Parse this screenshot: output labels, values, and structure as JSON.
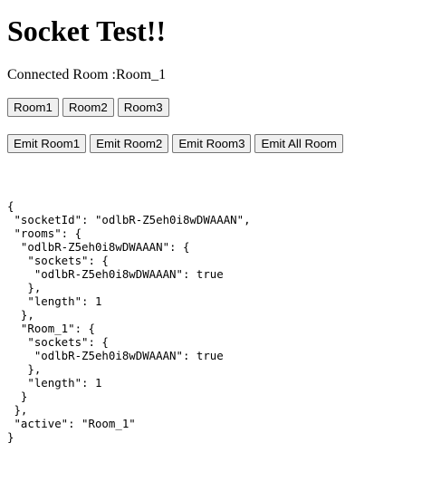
{
  "title": "Socket Test!!",
  "connected_room": {
    "label": "Connected Room :",
    "value": "Room_1"
  },
  "room_buttons": [
    "Room1",
    "Room2",
    "Room3"
  ],
  "emit_buttons": [
    "Emit Room1",
    "Emit Room2",
    "Emit Room3",
    "Emit All Room"
  ],
  "json_dump": "{\n \"socketId\": \"odlbR-Z5eh0i8wDWAAAN\",\n \"rooms\": {\n  \"odlbR-Z5eh0i8wDWAAAN\": {\n   \"sockets\": {\n    \"odlbR-Z5eh0i8wDWAAAN\": true\n   },\n   \"length\": 1\n  },\n  \"Room_1\": {\n   \"sockets\": {\n    \"odlbR-Z5eh0i8wDWAAAN\": true\n   },\n   \"length\": 1\n  }\n },\n \"active\": \"Room_1\"\n}"
}
